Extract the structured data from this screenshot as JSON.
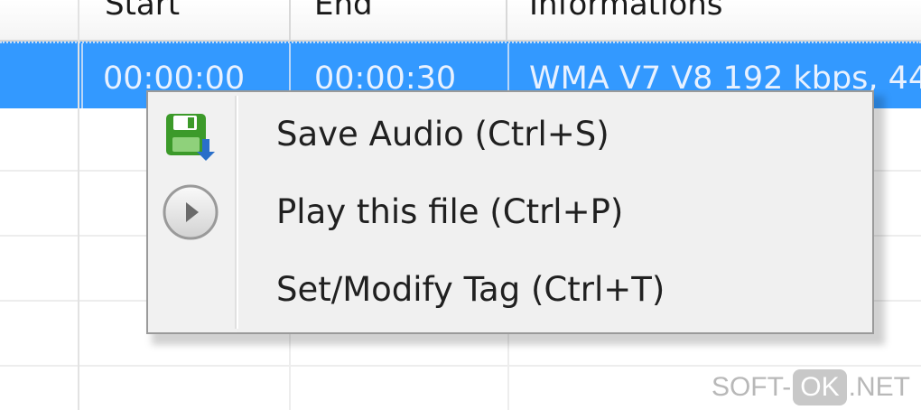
{
  "table": {
    "columns": [
      "Start",
      "End",
      "Informations"
    ],
    "selected_row": {
      "start": "00:00:00",
      "end": "00:00:30",
      "informations": "WMA V7 V8 192 kbps, 44"
    }
  },
  "context_menu": {
    "items": [
      {
        "label": "Save Audio (Ctrl+S)",
        "icon": "save-audio-icon"
      },
      {
        "label": "Play this file (Ctrl+P)",
        "icon": "play-icon"
      },
      {
        "label": "Set/Modify Tag (Ctrl+T)",
        "icon": ""
      }
    ]
  },
  "watermark": {
    "prefix": "SOFT-",
    "badge": "OK",
    "suffix": ".NET"
  },
  "colors": {
    "selection": "#3399ff",
    "menu_background": "#f0f0f0",
    "save_icon_green": "#3c9a2a",
    "arrow_blue": "#2a6fc9"
  }
}
